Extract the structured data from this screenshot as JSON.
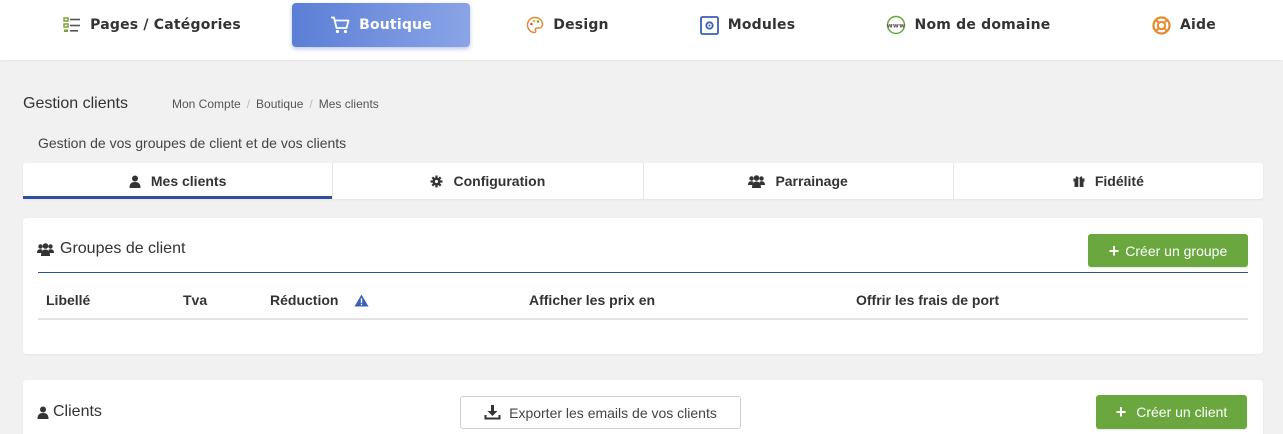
{
  "nav": {
    "items": [
      {
        "label": "Pages / Catégories",
        "icon": "list-icon"
      },
      {
        "label": "Boutique",
        "icon": "cart-icon",
        "active": true
      },
      {
        "label": "Design",
        "icon": "palette-icon"
      },
      {
        "label": "Modules",
        "icon": "module-icon"
      },
      {
        "label": "Nom de domaine",
        "icon": "www-globe-icon"
      },
      {
        "label": "Aide",
        "icon": "lifebuoy-icon"
      }
    ]
  },
  "header": {
    "title": "Gestion clients",
    "breadcrumb": [
      "Mon Compte",
      "Boutique",
      "Mes clients"
    ],
    "separator": "/",
    "subtitle": "Gestion de vos groupes de client et de vos clients"
  },
  "tabs": [
    {
      "label": "Mes clients",
      "icon": "user-icon",
      "active": true
    },
    {
      "label": "Configuration",
      "icon": "gear-icon"
    },
    {
      "label": "Parrainage",
      "icon": "users-icon"
    },
    {
      "label": "Fidélité",
      "icon": "gift-icon"
    }
  ],
  "groups_panel": {
    "title": "Groupes de client",
    "create_button": "Créer un groupe",
    "plus": "+",
    "columns": [
      "Libellé",
      "Tva",
      "Réduction",
      "Afficher les prix en",
      "Offrir les frais de port"
    ]
  },
  "clients_panel": {
    "title": "Clients",
    "export_button": "Exporter les emails de vos clients",
    "create_button": "Créer un client",
    "plus": "+"
  },
  "colors": {
    "accent_blue": "#2f4f9f",
    "active_nav_gradient_start": "#5b7fd6",
    "active_nav_gradient_end": "#8aa4e6",
    "green_button": "#6aa83f",
    "background": "#f1f1f1"
  }
}
